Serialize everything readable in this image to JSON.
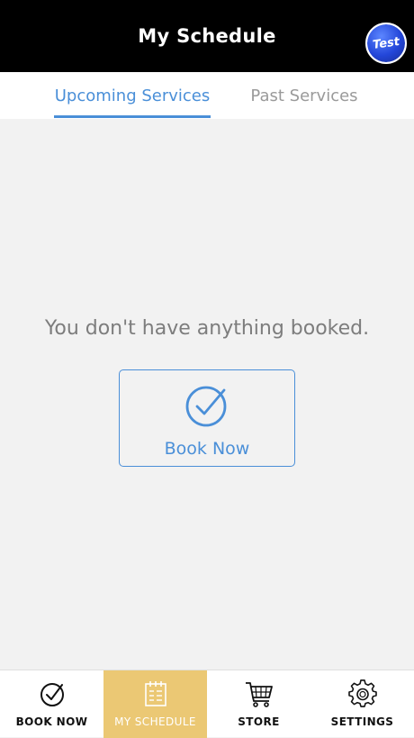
{
  "header": {
    "title": "My Schedule",
    "avatar_text": "Test"
  },
  "tabs": [
    {
      "label": "Upcoming Services",
      "active": true
    },
    {
      "label": "Past Services",
      "active": false
    }
  ],
  "empty_state": {
    "message": "You don't have anything booked.",
    "button_label": "Book Now",
    "icon": "check-circle-icon"
  },
  "bottom_nav": [
    {
      "label": "BOOK NOW",
      "icon": "check-circle-icon",
      "active": false
    },
    {
      "label": "MY SCHEDULE",
      "icon": "calendar-icon",
      "active": true
    },
    {
      "label": "STORE",
      "icon": "cart-icon",
      "active": false
    },
    {
      "label": "SETTINGS",
      "icon": "gear-icon",
      "active": false
    }
  ],
  "colors": {
    "accent": "#4a8fd8",
    "header_bg": "#000000",
    "nav_active": "#ebc874",
    "background": "#f2f2f2"
  }
}
